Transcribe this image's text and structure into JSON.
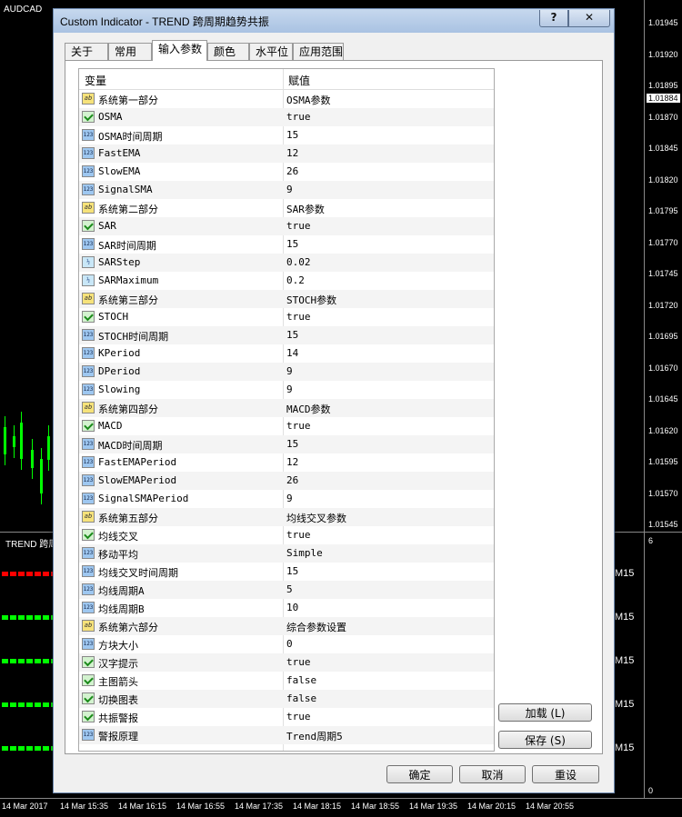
{
  "chart": {
    "symbol": "AUDCAD",
    "indicator_label": "TREND 跨周",
    "prices": [
      "1.01945",
      "1.01920",
      "1.01895",
      "1.01870",
      "1.01845",
      "1.01820",
      "1.01795",
      "1.01770",
      "1.01745",
      "1.01720",
      "1.01695",
      "1.01670",
      "1.01645",
      "1.01620",
      "1.01595",
      "1.01570",
      "1.01545"
    ],
    "current_price": "1.01884",
    "sub_axis_top": "6",
    "sub_axis_bottom": "0",
    "times": [
      "14 Mar 2017",
      "14 Mar 15:35",
      "14 Mar 16:15",
      "14 Mar 16:55",
      "14 Mar 17:35",
      "14 Mar 18:15",
      "14 Mar 18:55",
      "14 Mar 19:35",
      "14 Mar 20:15",
      "14 Mar 20:55"
    ],
    "timeframe_labels": [
      "M15",
      "M15",
      "M15",
      "M15",
      "M15"
    ],
    "colors": {
      "up": "#00ff00",
      "down": "#ff0000",
      "background": "#000000"
    }
  },
  "dialog": {
    "title": "Custom Indicator - TREND 跨周期趋势共振",
    "help_label": "?",
    "close_label": "✕",
    "tabs": [
      "关于",
      "常用",
      "输入参数",
      "颜色",
      "水平位",
      "应用范围"
    ],
    "active_tab": "输入参数",
    "columns": {
      "variable": "变量",
      "value": "赋值"
    },
    "params": [
      {
        "icon": "ab",
        "name": "系统第一部分",
        "value": "OSMA参数"
      },
      {
        "icon": "bool",
        "name": "OSMA",
        "value": "true"
      },
      {
        "icon": "num",
        "name": "OSMA时间周期",
        "value": "15"
      },
      {
        "icon": "num",
        "name": "FastEMA",
        "value": "12"
      },
      {
        "icon": "num",
        "name": "SlowEMA",
        "value": "26"
      },
      {
        "icon": "num",
        "name": "SignalSMA",
        "value": "9"
      },
      {
        "icon": "ab",
        "name": "系统第二部分",
        "value": "SAR参数"
      },
      {
        "icon": "bool",
        "name": "SAR",
        "value": "true"
      },
      {
        "icon": "num",
        "name": "SAR时间周期",
        "value": "15"
      },
      {
        "icon": "half",
        "name": "SARStep",
        "value": "0.02"
      },
      {
        "icon": "half",
        "name": "SARMaximum",
        "value": "0.2"
      },
      {
        "icon": "ab",
        "name": "系统第三部分",
        "value": "STOCH参数"
      },
      {
        "icon": "bool",
        "name": "STOCH",
        "value": "true"
      },
      {
        "icon": "num",
        "name": "STOCH时间周期",
        "value": "15"
      },
      {
        "icon": "num",
        "name": "KPeriod",
        "value": "14"
      },
      {
        "icon": "num",
        "name": "DPeriod",
        "value": "9"
      },
      {
        "icon": "num",
        "name": "Slowing",
        "value": "9"
      },
      {
        "icon": "ab",
        "name": "系统第四部分",
        "value": "MACD参数"
      },
      {
        "icon": "bool",
        "name": "MACD",
        "value": "true"
      },
      {
        "icon": "num",
        "name": "MACD时间周期",
        "value": "15"
      },
      {
        "icon": "num",
        "name": "FastEMAPeriod",
        "value": "12"
      },
      {
        "icon": "num",
        "name": "SlowEMAPeriod",
        "value": "26"
      },
      {
        "icon": "num",
        "name": "SignalSMAPeriod",
        "value": "9"
      },
      {
        "icon": "ab",
        "name": "系统第五部分",
        "value": "均线交叉参数"
      },
      {
        "icon": "bool",
        "name": "均线交叉",
        "value": "true"
      },
      {
        "icon": "num",
        "name": "移动平均",
        "value": "Simple"
      },
      {
        "icon": "num",
        "name": "均线交叉时间周期",
        "value": "15"
      },
      {
        "icon": "num",
        "name": "均线周期A",
        "value": "5"
      },
      {
        "icon": "num",
        "name": "均线周期B",
        "value": "10"
      },
      {
        "icon": "ab",
        "name": "系统第六部分",
        "value": "综合参数设置"
      },
      {
        "icon": "num",
        "name": "方块大小",
        "value": "0"
      },
      {
        "icon": "bool",
        "name": "汉字提示",
        "value": "true"
      },
      {
        "icon": "bool",
        "name": "主图箭头",
        "value": "false"
      },
      {
        "icon": "bool",
        "name": "切换图表",
        "value": "false"
      },
      {
        "icon": "bool",
        "name": "共振警报",
        "value": "true"
      },
      {
        "icon": "num",
        "name": "警报原理",
        "value": "Trend周期5"
      }
    ],
    "load_label": "加载 (L)",
    "save_label": "保存 (S)",
    "ok_label": "确定",
    "cancel_label": "取消",
    "reset_label": "重设"
  }
}
